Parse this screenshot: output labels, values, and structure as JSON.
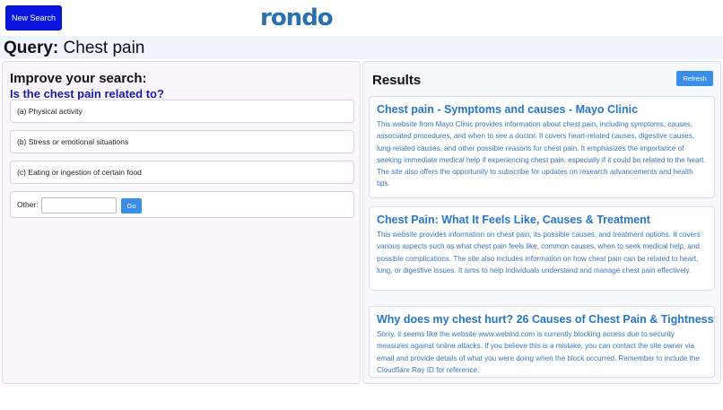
{
  "header": {
    "new_search_label": "New Search",
    "logo_text": "rondo"
  },
  "query": {
    "label": "Query:",
    "text": "Chest pain"
  },
  "refine": {
    "title": "Improve your search:",
    "question": "Is the chest pain related to?",
    "options": [
      "(a) Physical activity",
      "(b) Stress or emotional situations",
      "(c) Eating or ingestion of certain food"
    ],
    "other_label": "Other:",
    "other_value": "",
    "go_label": "Go"
  },
  "results": {
    "title": "Results",
    "refresh_label": "Refresh",
    "items": [
      {
        "title": "Chest pain - Symptoms and causes - Mayo Clinic",
        "description": "This website from Mayo Clinic provides information about chest pain, including symptoms, causes, associated procedures, and when to see a doctor. It covers heart-related causes, digestive causes, lung-related causes, and other possible reasons for chest pain. It emphasizes the importance of seeking immediate medical help if experiencing chest pain, especially if it could be related to the heart. The site also offers the opportunity to subscribe for updates on research advancements and health tips."
      },
      {
        "title": "Chest Pain: What It Feels Like, Causes & Treatment",
        "description": "This website provides information on chest pain, its possible causes, and treatment options. It covers various aspects such as what chest pain feels like, common causes, when to seek medical help, and possible complications. The site also includes information on how chest pain can be related to heart, lung, or digestive issues. It aims to help individuals understand and manage chest pain effectively."
      },
      {
        "title": "Why does my chest hurt? 26 Causes of Chest Pain & Tightness",
        "description": "Sorry, it seems like the website www.webmd.com is currently blocking access due to security measures against online attacks. If you believe this is a mistake, you can contact the site owner via email and provide details of what you were doing when the block occurred. Remember to include the Cloudflare Ray ID for reference."
      }
    ]
  }
}
